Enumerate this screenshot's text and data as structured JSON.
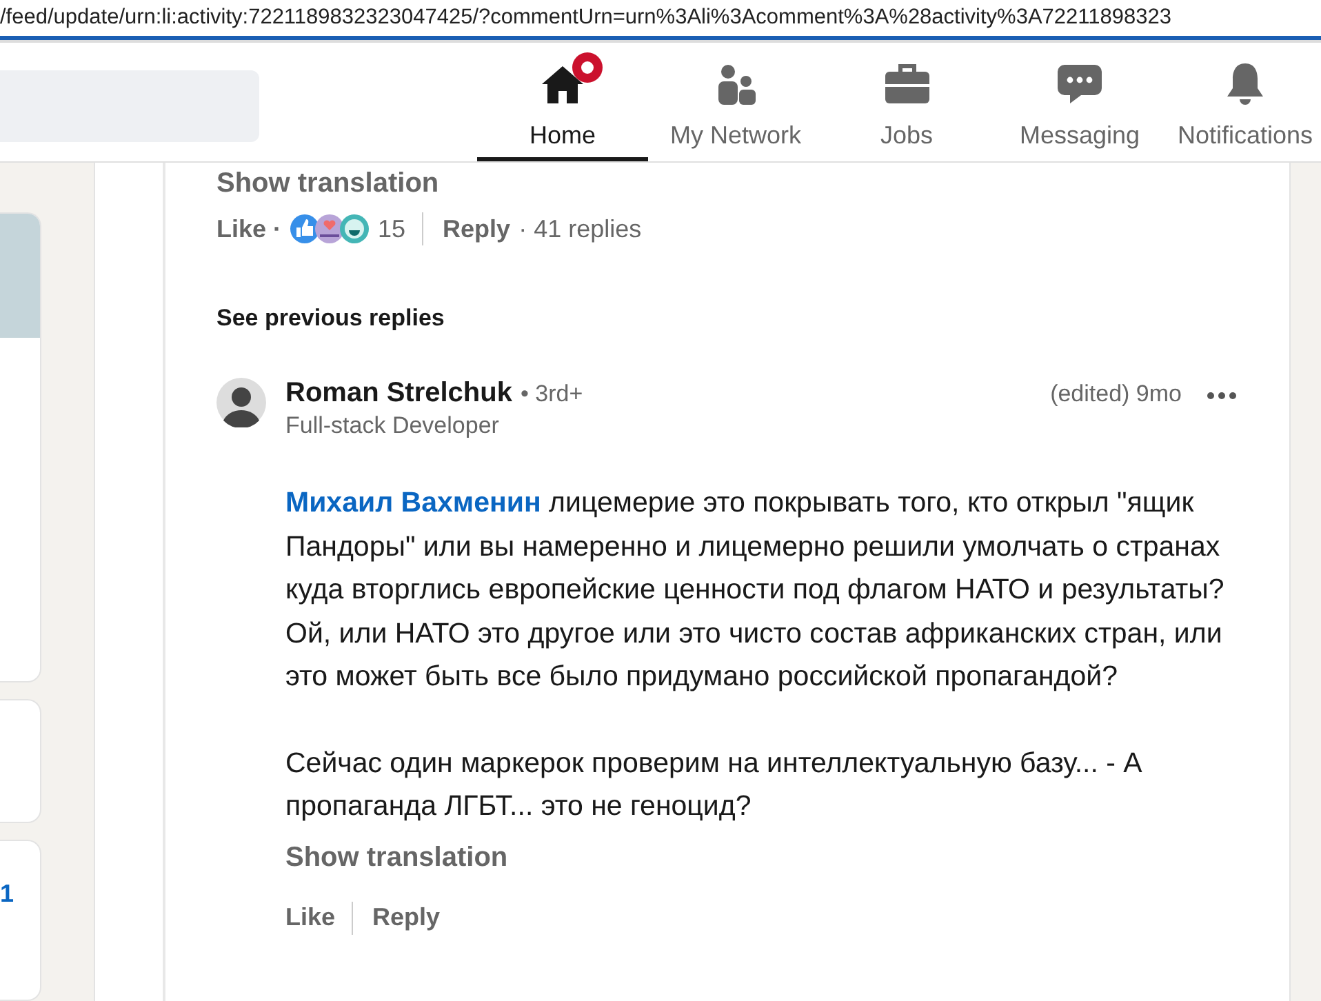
{
  "url": "/feed/update/urn:li:activity:7221189832323047425/?commentUrn=urn%3Ali%3Acomment%3A%28activity%3A72211898323",
  "nav": [
    {
      "label": "Home",
      "kind": "home",
      "selected": true,
      "badge": true
    },
    {
      "label": "My Network",
      "kind": "network",
      "selected": false,
      "badge": false
    },
    {
      "label": "Jobs",
      "kind": "jobs",
      "selected": false,
      "badge": false
    },
    {
      "label": "Messaging",
      "kind": "messaging",
      "selected": false,
      "badge": false
    },
    {
      "label": "Notifications",
      "kind": "notifications",
      "selected": false,
      "badge": false
    }
  ],
  "left_rail": {
    "count": "1"
  },
  "previous_comment": {
    "show_translation": "Show translation",
    "like": "Like ·",
    "reaction_count": "15",
    "reply": "Reply",
    "replies": "· 41 replies"
  },
  "see_previous": "See previous replies",
  "reply": {
    "author": "Roman Strelchuk",
    "degree": "• 3rd+",
    "headline": "Full-stack Developer",
    "meta": "(edited) 9mo",
    "mention": "Михаил Вахменин",
    "paragraphs": [
      "лицемерие это покрывать того, кто открыл \"ящик Пандоры\" или вы намеренно и лицемерно решили умолчать о странах куда вторглись европейские ценности под флагом НАТО и результаты? Ой, или НАТО это другое или это чисто состав африканских стран, или это может быть все было придумано российской пропагандой?",
      "Сейчас один маркерок проверим на интеллектуальную базу... - А пропаганда ЛГБТ... это не геноцид?"
    ],
    "show_translation": "Show translation",
    "actions": [
      "Like",
      "Reply"
    ]
  }
}
